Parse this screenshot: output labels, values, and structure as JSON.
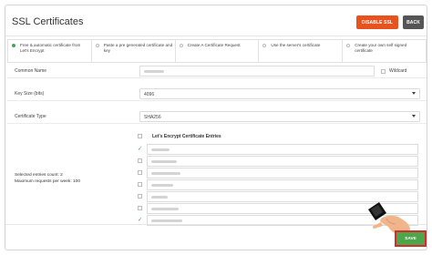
{
  "header": {
    "title": "SSL Certificates",
    "disable_label": "DISABLE SSL",
    "back_label": "BACK"
  },
  "tabs": [
    {
      "label": "Free & automatic certificate from Let's Encrypt",
      "selected": true
    },
    {
      "label": "Paste a pre generated certificate and key",
      "selected": false
    },
    {
      "label": "Create A Certificate Request",
      "selected": false
    },
    {
      "label": "Use the server's certificate",
      "selected": false
    },
    {
      "label": "Create your own self signed certificate",
      "selected": false
    }
  ],
  "form": {
    "common_name_label": "Common Name",
    "wildcard_label": "Wildcard",
    "key_size_label": "Key Size (bits)",
    "key_size_value": "4096",
    "certificate_type_label": "Certificate Type",
    "certificate_type_value": "SHA256"
  },
  "entries": {
    "title": "Let's Encrypt Certificate Entries",
    "items": [
      {
        "checked": true
      },
      {
        "checked": false
      },
      {
        "checked": false
      },
      {
        "checked": false
      },
      {
        "checked": false
      },
      {
        "checked": false
      },
      {
        "checked": true
      }
    ]
  },
  "summary": {
    "selected_count": "Selected entries count: 2",
    "max_requests": "Maximum requests per week: 100"
  },
  "footer": {
    "save_label": "SAVE"
  },
  "colors": {
    "accent_orange": "#e8521e",
    "back_gray": "#555555",
    "save_green": "#4da64a",
    "check_green": "#3aa15b",
    "highlight_red": "#d62b2b"
  }
}
